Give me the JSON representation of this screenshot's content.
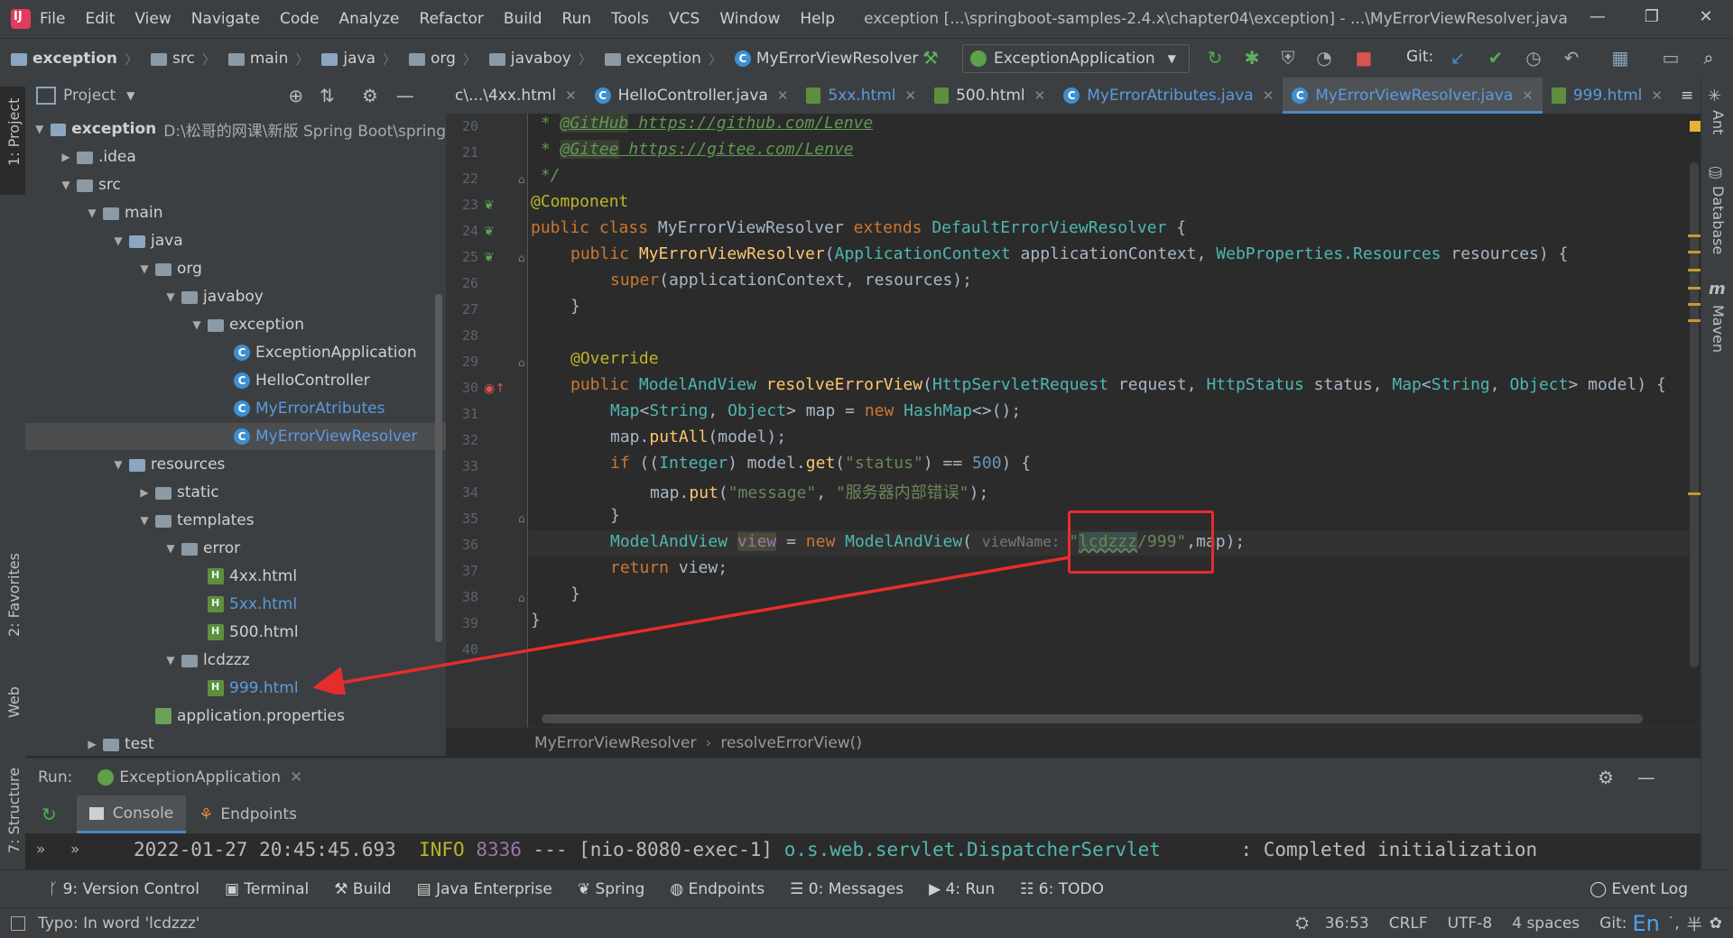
{
  "menu": [
    "File",
    "Edit",
    "View",
    "Navigate",
    "Code",
    "Analyze",
    "Refactor",
    "Build",
    "Run",
    "Tools",
    "VCS",
    "Window",
    "Help"
  ],
  "window_title": "exception [...\\springboot-samples-2.4.x\\chapter04\\exception] - ...\\MyErrorViewResolver.java",
  "breadcrumbs": [
    "exception",
    "src",
    "main",
    "java",
    "org",
    "javaboy",
    "exception",
    "MyErrorViewResolver"
  ],
  "run_config": "ExceptionApplication",
  "git_label": "Git:",
  "project_panel": {
    "title": "Project",
    "tree": [
      {
        "label": "exception",
        "extra": "D:\\松哥的网课\\新版 Spring Boot\\spring",
        "level": 0,
        "type": "module",
        "expanded": true
      },
      {
        "label": ".idea",
        "level": 1,
        "type": "folder",
        "expanded": false
      },
      {
        "label": "src",
        "level": 1,
        "type": "folder",
        "expanded": true
      },
      {
        "label": "main",
        "level": 2,
        "type": "folder",
        "expanded": true
      },
      {
        "label": "java",
        "level": 3,
        "type": "folder-src",
        "expanded": true
      },
      {
        "label": "org",
        "level": 4,
        "type": "folder",
        "expanded": true
      },
      {
        "label": "javaboy",
        "level": 5,
        "type": "folder",
        "expanded": true
      },
      {
        "label": "exception",
        "level": 6,
        "type": "folder",
        "expanded": true
      },
      {
        "label": "ExceptionApplication",
        "level": 7,
        "type": "class"
      },
      {
        "label": "HelloController",
        "level": 7,
        "type": "class"
      },
      {
        "label": "MyErrorAtributes",
        "level": 7,
        "type": "class",
        "color": "blue"
      },
      {
        "label": "MyErrorViewResolver",
        "level": 7,
        "type": "class",
        "color": "blue",
        "selected": true
      },
      {
        "label": "resources",
        "level": 3,
        "type": "folder-res",
        "expanded": true
      },
      {
        "label": "static",
        "level": 4,
        "type": "folder",
        "expanded": false
      },
      {
        "label": "templates",
        "level": 4,
        "type": "folder",
        "expanded": true
      },
      {
        "label": "error",
        "level": 5,
        "type": "folder",
        "expanded": true
      },
      {
        "label": "4xx.html",
        "level": 6,
        "type": "html"
      },
      {
        "label": "5xx.html",
        "level": 6,
        "type": "html",
        "color": "blue"
      },
      {
        "label": "500.html",
        "level": 6,
        "type": "html"
      },
      {
        "label": "lcdzzz",
        "level": 5,
        "type": "folder",
        "expanded": true
      },
      {
        "label": "999.html",
        "level": 6,
        "type": "html",
        "color": "blue"
      },
      {
        "label": "application.properties",
        "level": 4,
        "type": "props"
      },
      {
        "label": "test",
        "level": 2,
        "type": "folder",
        "expanded": false
      }
    ]
  },
  "tabs": [
    {
      "label": "c\\...\\4xx.html",
      "icon": "html-icon"
    },
    {
      "label": "HelloController.java",
      "icon": "class-icon"
    },
    {
      "label": "5xx.html",
      "icon": "html-icon",
      "color": "blue"
    },
    {
      "label": "500.html",
      "icon": "html-icon"
    },
    {
      "label": "MyErrorAtributes.java",
      "icon": "class-icon",
      "color": "blue"
    },
    {
      "label": "MyErrorViewResolver.java",
      "icon": "class-icon",
      "color": "blue",
      "active": true
    },
    {
      "label": "999.html",
      "icon": "html-icon",
      "color": "blue"
    }
  ],
  "tab_overflow": "≡",
  "editor": {
    "line_numbers": [
      "20",
      "21",
      "22",
      "23",
      "24",
      "25",
      "26",
      "27",
      "28",
      "29",
      "30",
      "31",
      "32",
      "33",
      "34",
      "35",
      "36",
      "37",
      "38",
      "39",
      "40"
    ],
    "line20": {
      "a": " * ",
      "b": "@GitHub",
      "c": " https://github.com/Lenve"
    },
    "line21": {
      "a": " * ",
      "b": "@Gitee",
      "c": " https://gitee.com/Lenve"
    },
    "line22": " */",
    "line23": "@Component",
    "line24": {
      "kw": "public class ",
      "name": "MyErrorViewResolver ",
      "kw2": "extends ",
      "sup": "DefaultErrorViewResolver",
      "rest": " {"
    },
    "line25": {
      "kw": "public ",
      "name": "MyErrorViewResolver",
      "p1": "(",
      "t1": "ApplicationContext",
      "v1": " applicationContext, ",
      "t2": "WebProperties.Resources",
      "v2": " resources) {"
    },
    "line26": {
      "kw": "super",
      "rest": "(applicationContext, resources);"
    },
    "line27": "}",
    "line29": "@Override",
    "line30": {
      "kw": "public ",
      "t": "ModelAndView ",
      "fn": "resolveErrorView",
      "p": "(",
      "t1": "HttpServletRequest",
      "v1": " request, ",
      "t2": "HttpStatus",
      "v2": " status, ",
      "t3": "Map",
      "g": "<",
      "t4": "String",
      "c": ", ",
      "t5": "Object",
      "g2": ">",
      "v3": " model) {"
    },
    "line31": {
      "t": "Map",
      "g": "<",
      "t1": "String",
      "c": ", ",
      "t2": "Object",
      "g2": ">",
      "v": " map = ",
      "kw": "new ",
      "t3": "HashMap",
      "rest": "<>();"
    },
    "line32": {
      "a": "map.",
      "m": "putAll",
      "b": "(model);"
    },
    "line33": {
      "kw": "if ",
      "a": "((",
      "t": "Integer",
      "b": ") model.",
      "m": "get",
      "c": "(",
      "s": "\"status\"",
      "d": ") == ",
      "n": "500",
      "e": ") {"
    },
    "line34": {
      "a": "map.",
      "m": "put",
      "b": "(",
      "s1": "\"message\"",
      "c": ", ",
      "s2": "\"服务器内部错误\"",
      "d": ");"
    },
    "line35": "}",
    "line36": {
      "t": "ModelAndView ",
      "v": "view",
      "a": " = ",
      "kw": "new ",
      "t2": "ModelAndView",
      "p": "( ",
      "hint": "viewName: ",
      "s1": "\"",
      "s2": "lcdzzz",
      "s3": "/999\"",
      "rest": ",map);"
    },
    "line37": {
      "kw": "return ",
      "rest": "view;"
    },
    "line38": "}",
    "line39": "}",
    "breadcrumb": [
      "MyErrorViewResolver",
      "resolveErrorView()"
    ]
  },
  "right_tools": [
    "Ant",
    "Database",
    "Maven"
  ],
  "left_tools": [
    "1: Project",
    "2: Favorites",
    "Web",
    "7: Structure"
  ],
  "run_panel": {
    "run_label": "Run:",
    "app": "ExceptionApplication",
    "tabs": [
      "Console",
      "Endpoints"
    ],
    "log": {
      "time": "2022-01-27 20:45:45.693",
      "level": "INFO",
      "pid": "8336",
      "mid": " --- [nio-8080-exec-1] ",
      "logger": "o.s.web.servlet.DispatcherServlet",
      "msg": "       : Completed initialization"
    }
  },
  "tool_tabs": [
    "9: Version Control",
    "Terminal",
    "Build",
    "Java Enterprise",
    "Spring",
    "Endpoints",
    "0: Messages",
    "4: Run",
    "6: TODO"
  ],
  "event_log": "Event Log",
  "status_bar": {
    "message": "Typo: In word 'lcdzzz'",
    "position": "36:53",
    "line_sep": "CRLF",
    "encoding": "UTF-8",
    "indent": "4 spaces",
    "git": "Git:",
    "ime": "En"
  }
}
